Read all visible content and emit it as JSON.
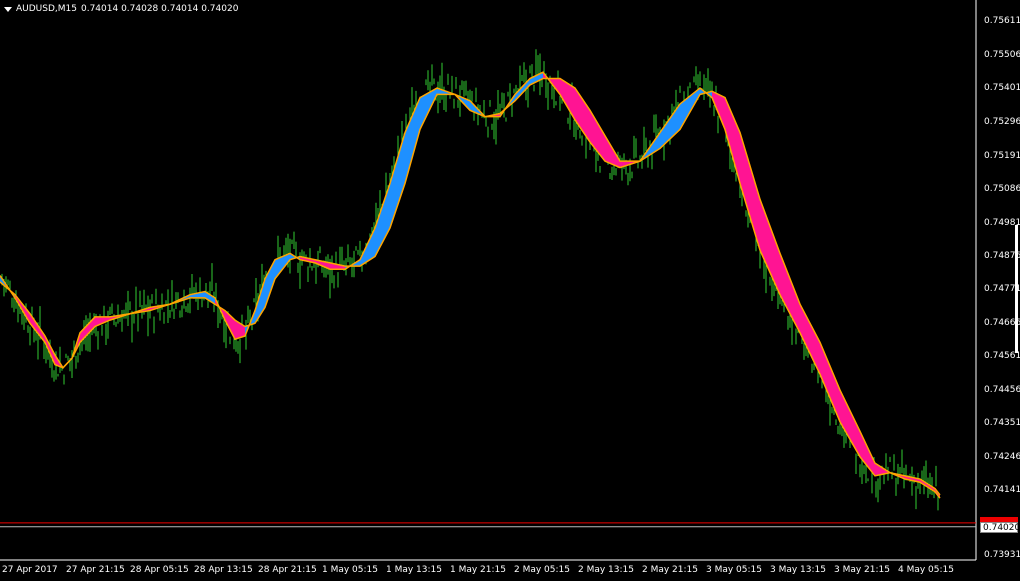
{
  "header": {
    "symbol": "AUDUSD,M15",
    "quotes": "0.74014 0.74028 0.74014 0.74020"
  },
  "price_axis": {
    "ticks": [
      "0.75611",
      "0.75506",
      "0.75401",
      "0.75296",
      "0.75191",
      "0.75086",
      "0.74981",
      "0.74876",
      "0.74771",
      "0.74666",
      "0.74561",
      "0.74456",
      "0.74351",
      "0.74246",
      "0.74141",
      "0.74020",
      "0.73931"
    ]
  },
  "time_axis": {
    "ticks": [
      "27 Apr 2017",
      "27 Apr 21:15",
      "28 Apr 05:15",
      "28 Apr 13:15",
      "28 Apr 21:15",
      "1 May 05:15",
      "1 May 13:15",
      "1 May 21:15",
      "2 May 05:15",
      "2 May 13:15",
      "2 May 21:15",
      "3 May 05:15",
      "3 May 13:15",
      "3 May 21:15",
      "4 May 05:15"
    ]
  },
  "current_price": "0.74020",
  "colors": {
    "background": "#000000",
    "bars": "#32cd32",
    "bull_ribbon": "#1e90ff",
    "bear_ribbon": "#ff1493",
    "ribbon_edge": "#ffa500",
    "bid_line": "#ffffff",
    "red_line": "#ff0000"
  },
  "chart_data": {
    "type": "line",
    "series": [
      {
        "values_note": "",
        "fast_ma": [
          [
            0,
            0.7481
          ],
          [
            15,
            0.7474
          ],
          [
            30,
            0.7466
          ],
          [
            45,
            0.746
          ],
          [
            55,
            0.7453
          ],
          [
            63,
            0.7452
          ],
          [
            72,
            0.7455
          ],
          [
            80,
            0.746
          ],
          [
            95,
            0.7465
          ],
          [
            110,
            0.7467
          ],
          [
            130,
            0.7469
          ],
          [
            150,
            0.747
          ],
          [
            170,
            0.7472
          ],
          [
            190,
            0.7475
          ],
          [
            205,
            0.7476
          ],
          [
            215,
            0.7474
          ],
          [
            225,
            0.7467
          ],
          [
            235,
            0.7461
          ],
          [
            245,
            0.7462
          ],
          [
            255,
            0.747
          ],
          [
            265,
            0.748
          ],
          [
            275,
            0.7486
          ],
          [
            290,
            0.7488
          ],
          [
            300,
            0.7486
          ],
          [
            315,
            0.7485
          ],
          [
            330,
            0.7483
          ],
          [
            345,
            0.7483
          ],
          [
            360,
            0.7486
          ],
          [
            375,
            0.7496
          ],
          [
            390,
            0.751
          ],
          [
            405,
            0.7526
          ],
          [
            420,
            0.7537
          ],
          [
            437,
            0.754
          ],
          [
            455,
            0.7538
          ],
          [
            470,
            0.7536
          ],
          [
            485,
            0.7531
          ],
          [
            500,
            0.7531
          ],
          [
            515,
            0.7538
          ],
          [
            530,
            0.7543
          ],
          [
            543,
            0.7545
          ],
          [
            560,
            0.7538
          ],
          [
            575,
            0.753
          ],
          [
            590,
            0.7523
          ],
          [
            605,
            0.7517
          ],
          [
            620,
            0.7515
          ],
          [
            640,
            0.7517
          ],
          [
            660,
            0.7526
          ],
          [
            680,
            0.7535
          ],
          [
            700,
            0.754
          ],
          [
            712,
            0.7537
          ],
          [
            725,
            0.7527
          ],
          [
            740,
            0.751
          ],
          [
            760,
            0.7489
          ],
          [
            780,
            0.7475
          ],
          [
            800,
            0.7463
          ],
          [
            820,
            0.745
          ],
          [
            840,
            0.7435
          ],
          [
            860,
            0.7424
          ],
          [
            875,
            0.7418
          ],
          [
            890,
            0.7419
          ],
          [
            905,
            0.7417
          ],
          [
            920,
            0.7416
          ],
          [
            935,
            0.7413
          ],
          [
            940,
            0.7411
          ]
        ],
        "slow_ma": [
          [
            0,
            0.7479
          ],
          [
            15,
            0.7475
          ],
          [
            30,
            0.7469
          ],
          [
            45,
            0.7462
          ],
          [
            55,
            0.7456
          ],
          [
            63,
            0.7452
          ],
          [
            72,
            0.7455
          ],
          [
            80,
            0.7463
          ],
          [
            95,
            0.7468
          ],
          [
            110,
            0.7468
          ],
          [
            130,
            0.7469
          ],
          [
            150,
            0.7471
          ],
          [
            170,
            0.7472
          ],
          [
            190,
            0.7474
          ],
          [
            205,
            0.7474
          ],
          [
            215,
            0.7472
          ],
          [
            225,
            0.747
          ],
          [
            235,
            0.7467
          ],
          [
            245,
            0.7465
          ],
          [
            255,
            0.7466
          ],
          [
            265,
            0.7471
          ],
          [
            275,
            0.748
          ],
          [
            290,
            0.7486
          ],
          [
            300,
            0.7487
          ],
          [
            315,
            0.7486
          ],
          [
            330,
            0.7485
          ],
          [
            345,
            0.7484
          ],
          [
            360,
            0.7484
          ],
          [
            375,
            0.7487
          ],
          [
            390,
            0.7496
          ],
          [
            405,
            0.751
          ],
          [
            420,
            0.7527
          ],
          [
            437,
            0.7538
          ],
          [
            455,
            0.7538
          ],
          [
            470,
            0.7533
          ],
          [
            485,
            0.7531
          ],
          [
            500,
            0.7532
          ],
          [
            515,
            0.7536
          ],
          [
            530,
            0.7541
          ],
          [
            543,
            0.7543
          ],
          [
            560,
            0.7543
          ],
          [
            575,
            0.754
          ],
          [
            590,
            0.7533
          ],
          [
            605,
            0.7525
          ],
          [
            620,
            0.7517
          ],
          [
            640,
            0.7517
          ],
          [
            660,
            0.7521
          ],
          [
            680,
            0.7527
          ],
          [
            700,
            0.7538
          ],
          [
            712,
            0.7539
          ],
          [
            725,
            0.7537
          ],
          [
            740,
            0.7526
          ],
          [
            760,
            0.7505
          ],
          [
            780,
            0.7488
          ],
          [
            800,
            0.7472
          ],
          [
            820,
            0.746
          ],
          [
            840,
            0.7445
          ],
          [
            860,
            0.7432
          ],
          [
            875,
            0.7422
          ],
          [
            890,
            0.7419
          ],
          [
            905,
            0.7418
          ],
          [
            920,
            0.7417
          ],
          [
            935,
            0.7414
          ],
          [
            940,
            0.7412
          ]
        ]
      }
    ],
    "bid_price": 0.7402,
    "red_line_price": 0.74032,
    "ylim": [
      0.73931,
      0.75611
    ]
  }
}
